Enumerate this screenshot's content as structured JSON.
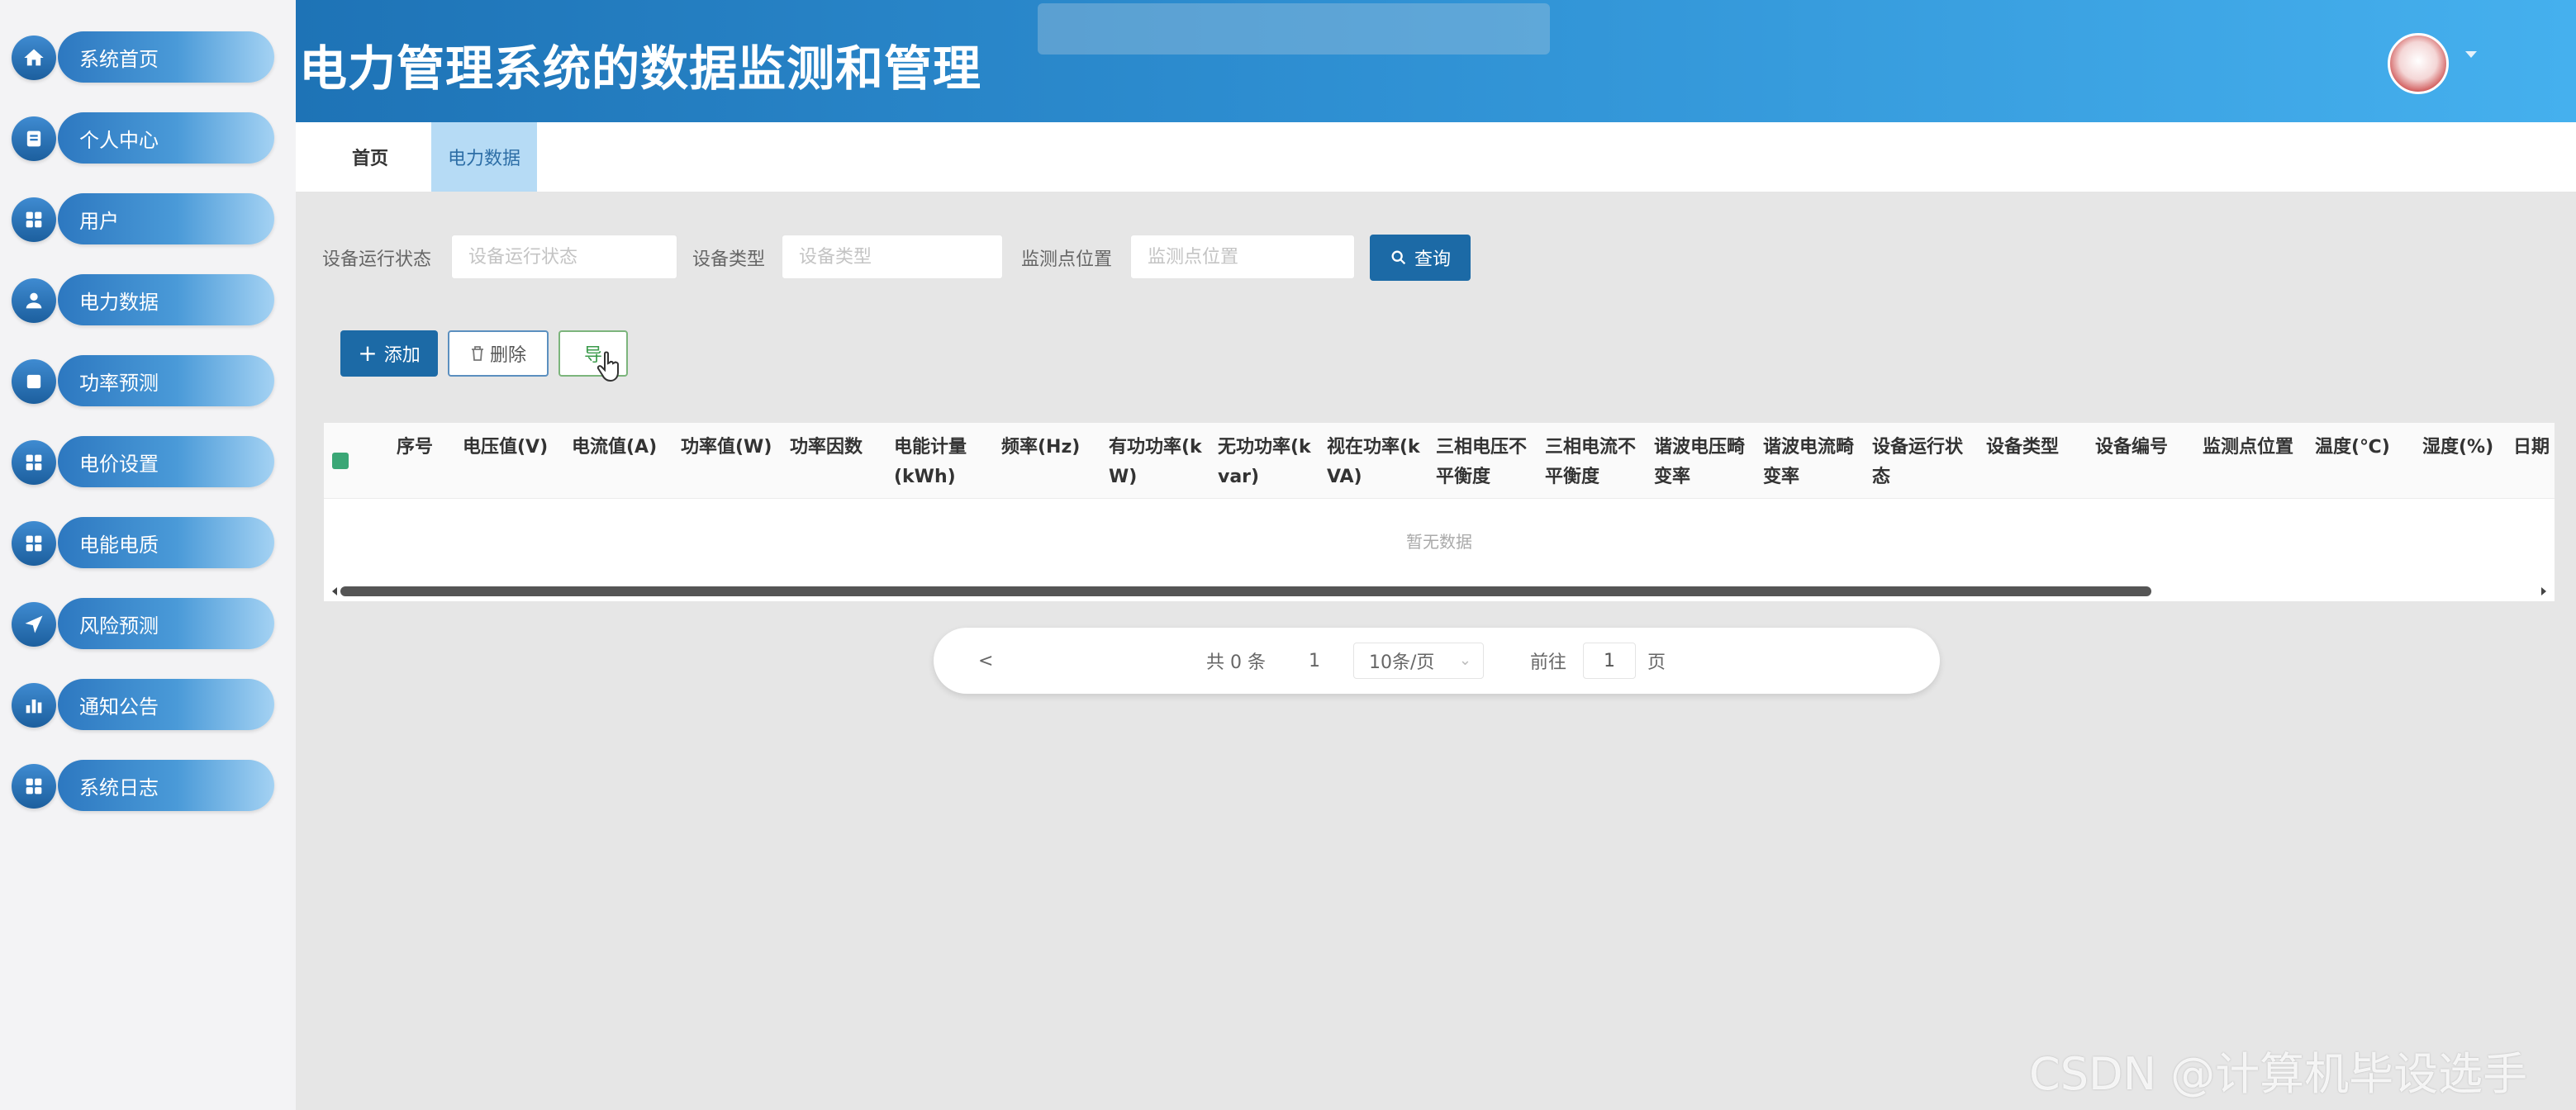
{
  "sidebar": {
    "items": [
      {
        "label": "系统首页",
        "icon": "home-icon"
      },
      {
        "label": "个人中心",
        "icon": "profile-icon"
      },
      {
        "label": "用户",
        "icon": "grid-icon"
      },
      {
        "label": "电力数据",
        "icon": "user-icon"
      },
      {
        "label": "功率预测",
        "icon": "list-icon"
      },
      {
        "label": "电价设置",
        "icon": "grid-icon"
      },
      {
        "label": "电能电质",
        "icon": "grid-icon"
      },
      {
        "label": "风险预测",
        "icon": "send-icon"
      },
      {
        "label": "通知公告",
        "icon": "chart-icon"
      },
      {
        "label": "系统日志",
        "icon": "grid-icon"
      }
    ]
  },
  "header": {
    "title": "电力管理系统的数据监测和管理"
  },
  "tabs": [
    {
      "label": "首页"
    },
    {
      "label": "电力数据"
    }
  ],
  "search": {
    "status_label": "设备运行状态",
    "status_placeholder": "设备运行状态",
    "type_label": "设备类型",
    "type_placeholder": "设备类型",
    "location_label": "监测点位置",
    "location_placeholder": "监测点位置",
    "query_label": "查询"
  },
  "actions": {
    "add_label": "添加",
    "delete_label": "删除",
    "export_label": "导"
  },
  "table": {
    "columns": [
      "序号",
      "电压值(V)",
      "电流值(A)",
      "功率值(W)",
      "功率因数",
      "电能计量(kWh)",
      "频率(Hz)",
      "有功功率(kW)",
      "无功功率(kvar)",
      "视在功率(kVA)",
      "三相电压不平衡度",
      "三相电流不平衡度",
      "谐波电压畸变率",
      "谐波电流畸变率",
      "设备运行状态",
      "设备类型",
      "设备编号",
      "监测点位置",
      "温度(℃)",
      "湿度(%)",
      "日期"
    ],
    "empty_text": "暂无数据"
  },
  "pagination": {
    "prev": "<",
    "total": "共 0 条",
    "current_page": "1",
    "page_size": "10条/页",
    "goto_label": "前往",
    "goto_value": "1",
    "page_suffix": "页"
  },
  "watermark": "CSDN @计算机毕设选手"
}
